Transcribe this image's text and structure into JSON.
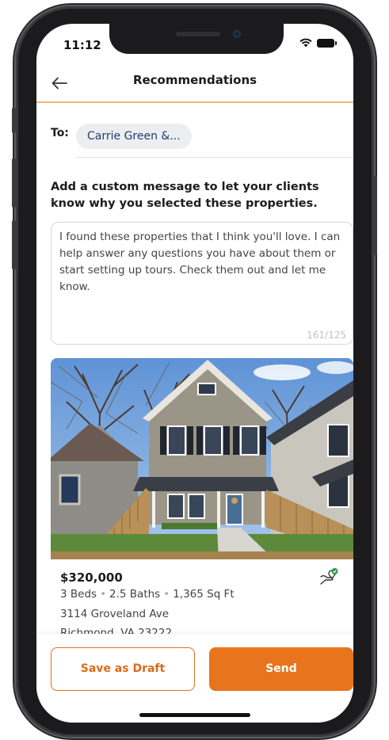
{
  "status_bar": {
    "time": "11:12"
  },
  "header": {
    "title": "Recommendations",
    "back_icon": "back-arrow-icon"
  },
  "recipients": {
    "label": "To:",
    "chip": "Carrie Green &..."
  },
  "message": {
    "prompt": "Add a custom message to let your clients know why you selected these properties.",
    "text": "I found these properties that I think you'll love. I can help answer any questions you have about them or start setting up tours. Check them out and let me know.",
    "char_count": "161/125"
  },
  "listing": {
    "price": "$320,000",
    "beds": "3 Beds",
    "baths": "2.5 Baths",
    "sqft": "1,365 Sq Ft",
    "address": "3114 Groveland Ave",
    "city": "Richmond, VA 23222",
    "icon": "recommend-hand-icon"
  },
  "actions": {
    "draft_label": "Save as Draft",
    "send_label": "Send"
  },
  "colors": {
    "accent": "#e8741d",
    "chip_bg": "#eceef1",
    "chip_text": "#1e3f6b"
  }
}
